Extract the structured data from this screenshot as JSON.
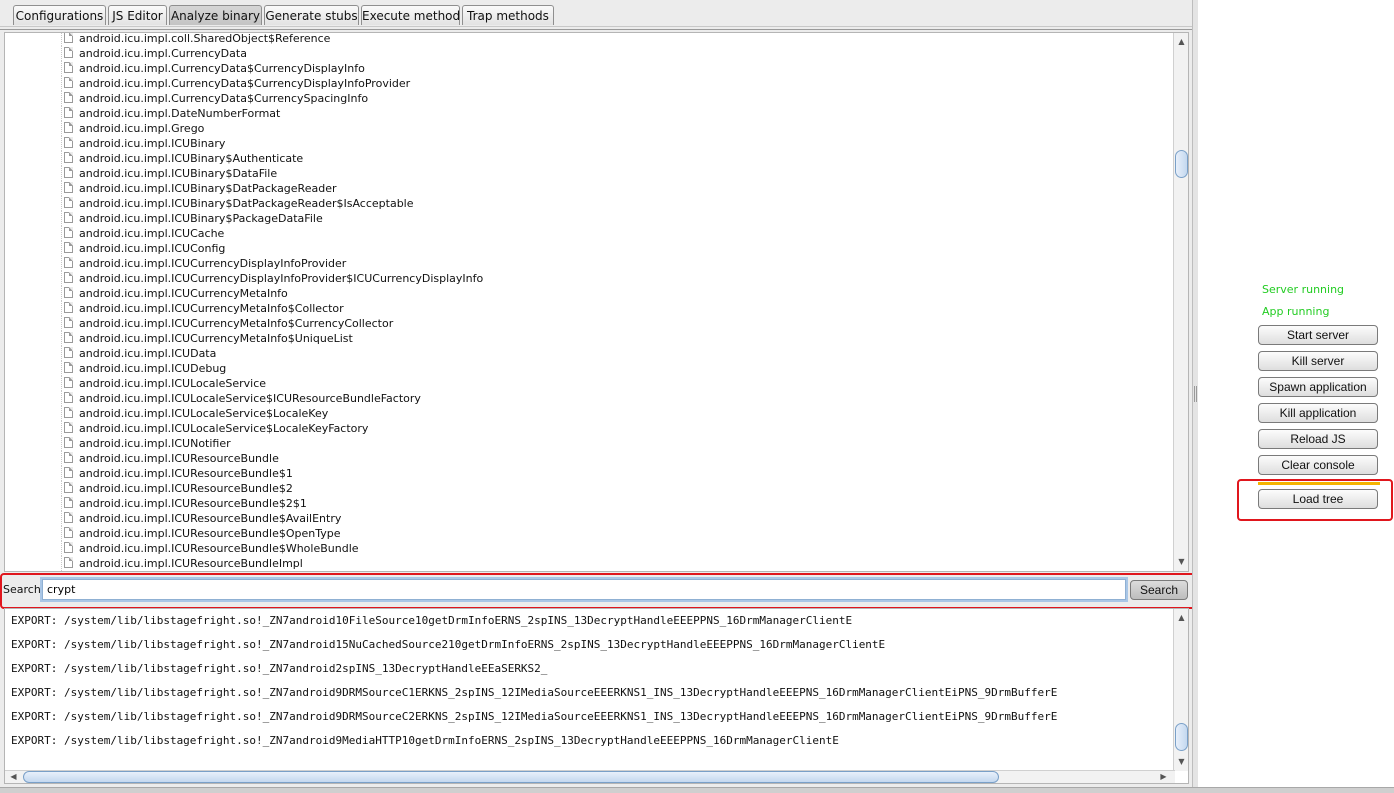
{
  "tabs": [
    {
      "label": "Configurations"
    },
    {
      "label": "JS Editor"
    },
    {
      "label": "Analyze binary",
      "active": true
    },
    {
      "label": "Generate stubs"
    },
    {
      "label": "Execute method"
    },
    {
      "label": "Trap methods"
    }
  ],
  "tree": {
    "items": [
      "android.icu.impl.coll.SharedObject$Reference",
      "android.icu.impl.CurrencyData",
      "android.icu.impl.CurrencyData$CurrencyDisplayInfo",
      "android.icu.impl.CurrencyData$CurrencyDisplayInfoProvider",
      "android.icu.impl.CurrencyData$CurrencySpacingInfo",
      "android.icu.impl.DateNumberFormat",
      "android.icu.impl.Grego",
      "android.icu.impl.ICUBinary",
      "android.icu.impl.ICUBinary$Authenticate",
      "android.icu.impl.ICUBinary$DataFile",
      "android.icu.impl.ICUBinary$DatPackageReader",
      "android.icu.impl.ICUBinary$DatPackageReader$IsAcceptable",
      "android.icu.impl.ICUBinary$PackageDataFile",
      "android.icu.impl.ICUCache",
      "android.icu.impl.ICUConfig",
      "android.icu.impl.ICUCurrencyDisplayInfoProvider",
      "android.icu.impl.ICUCurrencyDisplayInfoProvider$ICUCurrencyDisplayInfo",
      "android.icu.impl.ICUCurrencyMetaInfo",
      "android.icu.impl.ICUCurrencyMetaInfo$Collector",
      "android.icu.impl.ICUCurrencyMetaInfo$CurrencyCollector",
      "android.icu.impl.ICUCurrencyMetaInfo$UniqueList",
      "android.icu.impl.ICUData",
      "android.icu.impl.ICUDebug",
      "android.icu.impl.ICULocaleService",
      "android.icu.impl.ICULocaleService$ICUResourceBundleFactory",
      "android.icu.impl.ICULocaleService$LocaleKey",
      "android.icu.impl.ICULocaleService$LocaleKeyFactory",
      "android.icu.impl.ICUNotifier",
      "android.icu.impl.ICUResourceBundle",
      "android.icu.impl.ICUResourceBundle$1",
      "android.icu.impl.ICUResourceBundle$2",
      "android.icu.impl.ICUResourceBundle$2$1",
      "android.icu.impl.ICUResourceBundle$AvailEntry",
      "android.icu.impl.ICUResourceBundle$OpenType",
      "android.icu.impl.ICUResourceBundle$WholeBundle",
      "android.icu.impl.ICUResourceBundleImpl"
    ]
  },
  "search": {
    "label": "Search:",
    "value": "crypt",
    "button_label": "Search"
  },
  "console": {
    "lines": [
      "EXPORT: /system/lib/libstagefright.so!_ZN7android10FileSource10getDrmInfoERNS_2spINS_13DecryptHandleEEEPPNS_16DrmManagerClientE",
      "EXPORT: /system/lib/libstagefright.so!_ZN7android15NuCachedSource210getDrmInfoERNS_2spINS_13DecryptHandleEEEPPNS_16DrmManagerClientE",
      "EXPORT: /system/lib/libstagefright.so!_ZN7android2spINS_13DecryptHandleEEaSERKS2_",
      "EXPORT: /system/lib/libstagefright.so!_ZN7android9DRMSourceC1ERKNS_2spINS_12IMediaSourceEEERKNS1_INS_13DecryptHandleEEEPNS_16DrmManagerClientEiPNS_9DrmBufferE",
      "EXPORT: /system/lib/libstagefright.so!_ZN7android9DRMSourceC2ERKNS_2spINS_12IMediaSourceEEERKNS1_INS_13DecryptHandleEEEPNS_16DrmManagerClientEiPNS_9DrmBufferE",
      "EXPORT: /system/lib/libstagefright.so!_ZN7android9MediaHTTP10getDrmInfoERNS_2spINS_13DecryptHandleEEEPPNS_16DrmManagerClientE"
    ]
  },
  "status": {
    "server": "Server running",
    "app": "App running",
    "color": "#22cc22"
  },
  "actions": {
    "start_server": "Start server",
    "kill_server": "Kill server",
    "spawn_application": "Spawn application",
    "kill_application": "Kill application",
    "reload_js": "Reload JS",
    "clear_console": "Clear console",
    "load_tree": "Load tree"
  },
  "colors": {
    "highlight_red": "#e0161d",
    "accent_yellow": "#f5b400"
  }
}
